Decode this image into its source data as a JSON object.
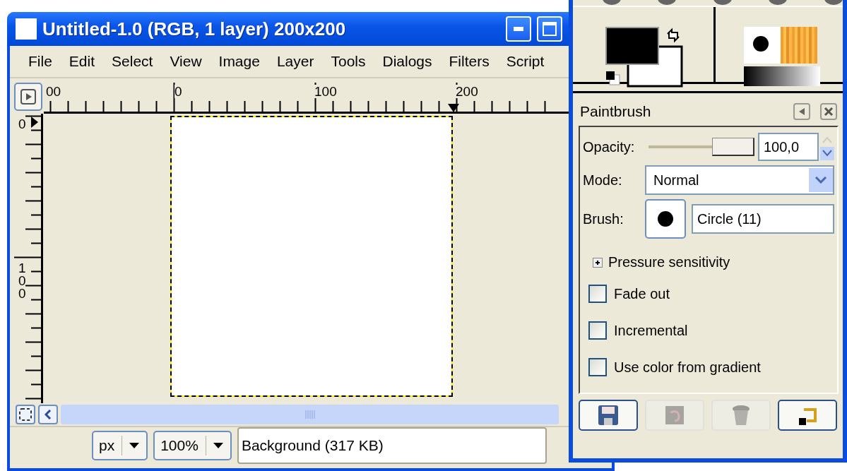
{
  "image_window": {
    "title": "Untitled-1.0 (RGB, 1 layer) 200x200",
    "menu": [
      "File",
      "Edit",
      "Select",
      "View",
      "Image",
      "Layer",
      "Tools",
      "Dialogs",
      "Filters",
      "Script"
    ],
    "ruler": {
      "horizontal_labels": [
        "00",
        "0",
        "100",
        "200"
      ],
      "vertical_labels": [
        "0",
        "100"
      ]
    },
    "status_bar": {
      "unit": "px",
      "zoom": "100%",
      "message": "Background (317 KB)"
    }
  },
  "toolbox": {
    "swatches": [
      {
        "color": "#000000"
      },
      {
        "color": "#ffffff"
      }
    ],
    "dock_title": "Paintbrush",
    "opacity": {
      "label": "Opacity:",
      "level": 1.0,
      "value": "100,0"
    },
    "mode": {
      "label": "Mode:",
      "value": "Normal"
    },
    "brush": {
      "label": "Brush:",
      "value": "Circle (11)"
    },
    "expander": {
      "label": "Pressure sensitivity",
      "expanded": false
    },
    "options": [
      {
        "label": "Fade out",
        "checked": false
      },
      {
        "label": "Incremental",
        "checked": false
      },
      {
        "label": "Use color from gradient",
        "checked": false
      }
    ],
    "buttons": [
      {
        "kind": "save",
        "disabled": false
      },
      {
        "kind": "restore",
        "disabled": true
      },
      {
        "kind": "delete",
        "disabled": true
      },
      {
        "kind": "reset",
        "disabled": false
      }
    ]
  }
}
